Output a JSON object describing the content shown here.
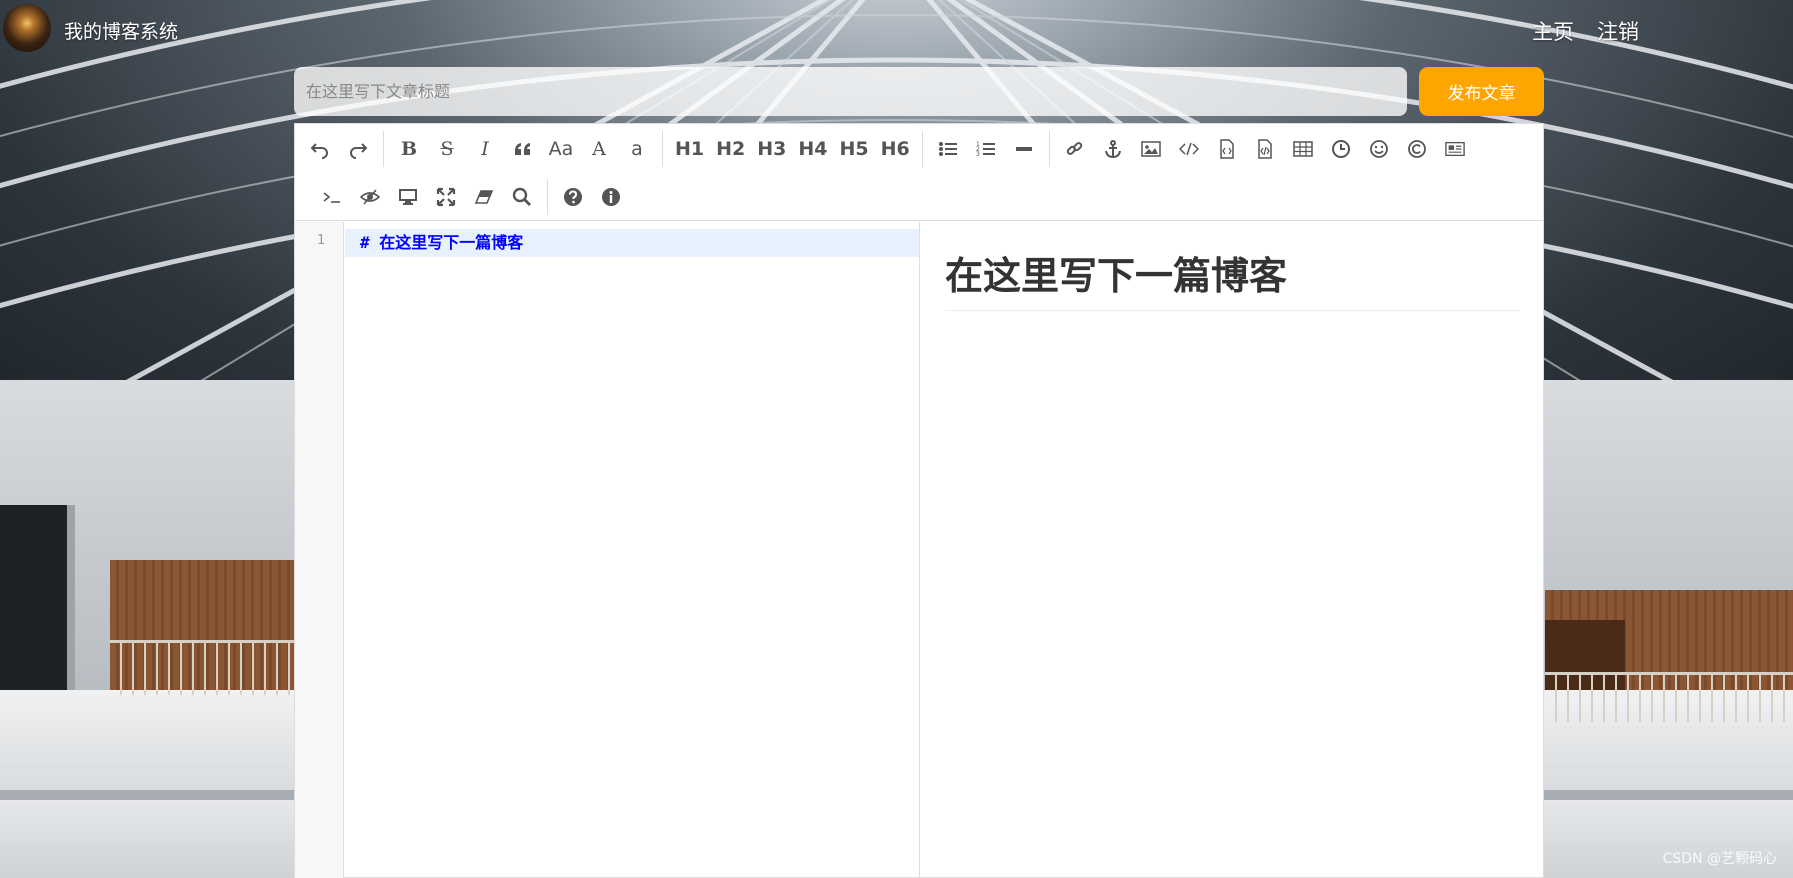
{
  "nav": {
    "site_title": "我的博客系统",
    "home_label": "主页",
    "logout_label": "注销"
  },
  "editor_header": {
    "title_placeholder": "在这里写下文章标题",
    "publish_label": "发布文章"
  },
  "toolbar": {
    "row1": [
      {
        "name": "undo-icon",
        "type": "icon"
      },
      {
        "name": "redo-icon",
        "type": "icon"
      },
      {
        "type": "sep"
      },
      {
        "name": "bold-button",
        "text": "B"
      },
      {
        "name": "strikethrough-button",
        "text": "S"
      },
      {
        "name": "italic-button",
        "text": "I"
      },
      {
        "name": "quote-icon",
        "type": "icon"
      },
      {
        "name": "uppercase-button",
        "text": "Aa"
      },
      {
        "name": "uppercase-first-button",
        "text": "A"
      },
      {
        "name": "lowercase-button",
        "text": "a"
      },
      {
        "type": "sep"
      },
      {
        "name": "h1-button",
        "text": "H1"
      },
      {
        "name": "h2-button",
        "text": "H2"
      },
      {
        "name": "h3-button",
        "text": "H3"
      },
      {
        "name": "h4-button",
        "text": "H4"
      },
      {
        "name": "h5-button",
        "text": "H5"
      },
      {
        "name": "h6-button",
        "text": "H6"
      },
      {
        "type": "sep"
      },
      {
        "name": "unordered-list-icon",
        "type": "icon"
      },
      {
        "name": "ordered-list-icon",
        "type": "icon"
      },
      {
        "name": "horizontal-rule-icon",
        "type": "icon"
      },
      {
        "type": "sep"
      },
      {
        "name": "link-icon",
        "type": "icon"
      },
      {
        "name": "anchor-icon",
        "type": "icon"
      },
      {
        "name": "image-icon",
        "type": "icon"
      },
      {
        "name": "inline-code-icon",
        "type": "icon"
      },
      {
        "name": "code-block-icon",
        "type": "icon"
      },
      {
        "name": "preformatted-text-icon",
        "type": "icon"
      },
      {
        "name": "table-icon",
        "type": "icon"
      },
      {
        "name": "datetime-icon",
        "type": "icon"
      },
      {
        "name": "emoji-icon",
        "type": "icon"
      },
      {
        "name": "html-entities-icon",
        "type": "icon"
      },
      {
        "name": "pagebreak-icon",
        "type": "icon"
      }
    ],
    "row2": [
      {
        "name": "terminal-icon",
        "type": "icon"
      },
      {
        "name": "toggle-preview-icon",
        "type": "icon"
      },
      {
        "name": "fullscreen-preview-icon",
        "type": "icon"
      },
      {
        "name": "fullscreen-icon",
        "type": "icon"
      },
      {
        "name": "clear-icon",
        "type": "icon"
      },
      {
        "name": "search-icon",
        "type": "icon"
      },
      {
        "type": "sep"
      },
      {
        "name": "help-icon",
        "type": "icon"
      },
      {
        "name": "info-icon",
        "type": "icon"
      }
    ]
  },
  "code": {
    "line_number": "1",
    "line_text": "#  在这里写下一篇博客"
  },
  "preview": {
    "heading": "在这里写下一篇博客"
  },
  "watermark": "CSDN @艺颗码心",
  "colors": {
    "publish_button": "#fea500",
    "markdown_heading": "#0000ff",
    "active_line": "#e8f2ff"
  }
}
